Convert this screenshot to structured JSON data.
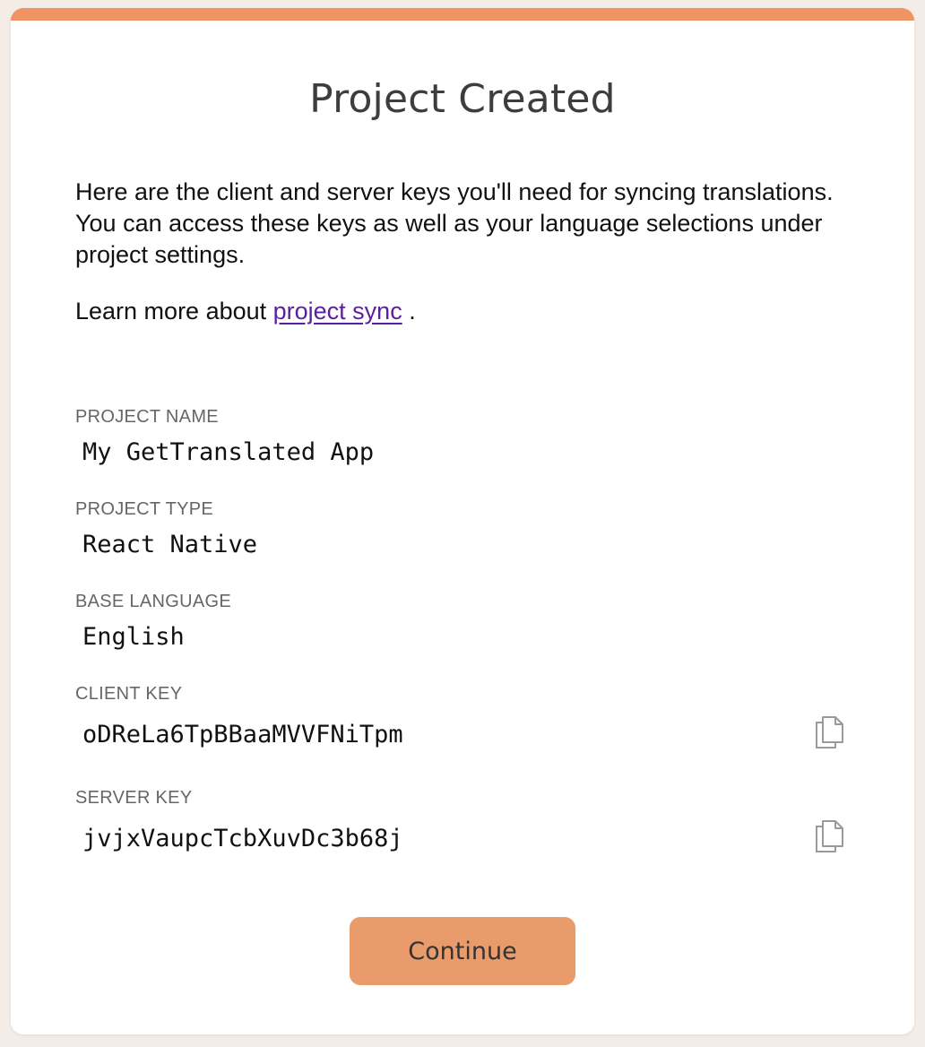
{
  "dialog": {
    "title": "Project Created",
    "intro": "Here are the client and server keys you'll need for syncing translations. You can access these keys as well as your language selections under project settings.",
    "learn_more_prefix": "Learn more about ",
    "learn_more_link": "project sync",
    "learn_more_suffix": " .",
    "continue_label": "Continue"
  },
  "fields": {
    "project_name": {
      "label": "PROJECT NAME",
      "value": "My GetTranslated App"
    },
    "project_type": {
      "label": "PROJECT TYPE",
      "value": "React Native"
    },
    "base_language": {
      "label": "BASE LANGUAGE",
      "value": "English"
    },
    "client_key": {
      "label": "CLIENT KEY",
      "value": "oDReLa6TpBBaaMVVFNiTpm"
    },
    "server_key": {
      "label": "SERVER KEY",
      "value": "jvjxVaupcTcbXuvDc3b68j"
    }
  },
  "icons": {
    "copy": "copy-icon"
  },
  "colors": {
    "accent": "#ef9462",
    "button": "#e99b6b",
    "link": "#5a1f9e",
    "background": "#f4ede7"
  }
}
